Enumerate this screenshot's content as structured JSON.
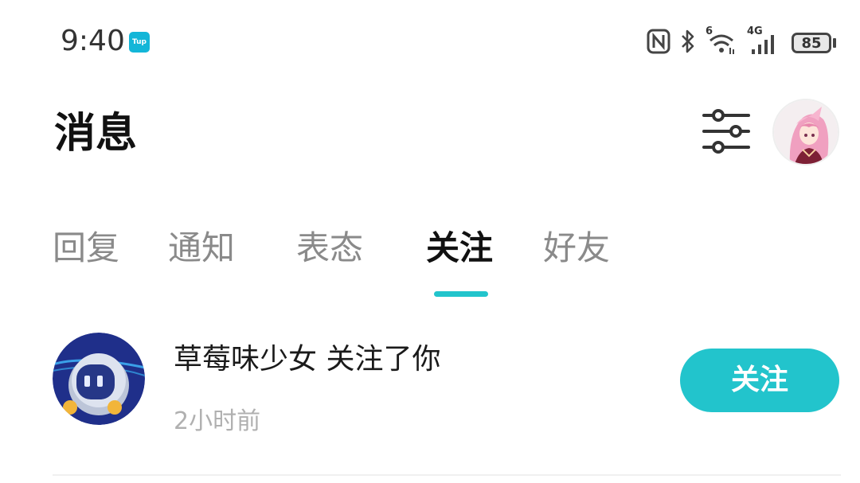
{
  "status_bar": {
    "time": "9:40",
    "app_badge": "Tup",
    "icons": [
      "nfc-icon",
      "bluetooth-icon",
      "wifi-6-icon",
      "4g-signal-icon",
      "battery-icon"
    ],
    "wifi_label": "6",
    "network_label": "4G",
    "battery": "85"
  },
  "header": {
    "title": "消息"
  },
  "tabs": [
    {
      "label": "回复"
    },
    {
      "label": "通知"
    },
    {
      "label": "表态"
    },
    {
      "label": "关注"
    },
    {
      "label": "好友"
    }
  ],
  "active_tab": "关注",
  "notifications": [
    {
      "text": "草莓味少女 关注了你",
      "time": "2小时前",
      "button_label": "关注"
    }
  ],
  "colors": {
    "accent": "#22c4cc",
    "inactive_tab": "#8a8a8a",
    "timestamp": "#b0b0b0"
  }
}
